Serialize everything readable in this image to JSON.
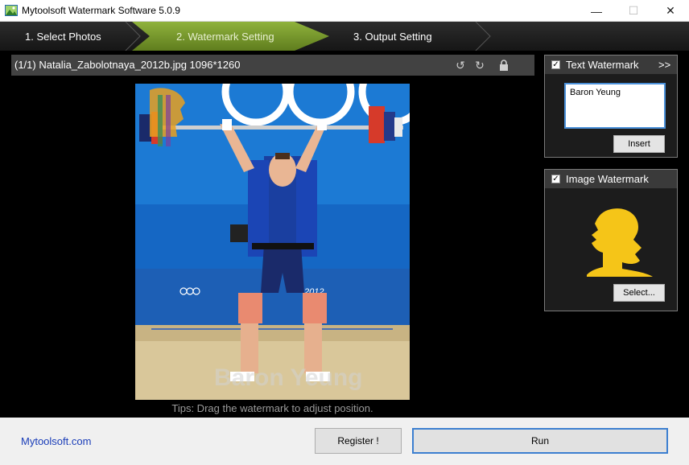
{
  "window": {
    "title": "Mytoolsoft Watermark Software 5.0.9",
    "min_glyph": "—",
    "max_glyph": "☐",
    "close_glyph": "✕"
  },
  "steps": [
    {
      "label": "1. Select Photos",
      "active": false
    },
    {
      "label": "2. Watermark Setting",
      "active": true
    },
    {
      "label": "3. Output Setting",
      "active": false
    }
  ],
  "preview": {
    "file_info": "(1/1) Natalia_Zabolotnaya_2012b.jpg 1096*1260",
    "watermark_text": "Baron Yeung",
    "tips": "Tips: Drag the watermark to adjust position.",
    "photo_caption_olympics": "2012",
    "icons": {
      "rotate_left": "rotate-left-icon",
      "rotate_right": "rotate-right-icon",
      "lock": "lock-icon"
    }
  },
  "text_watermark": {
    "title": "Text Watermark",
    "expand": ">>",
    "checked": true,
    "value": "Baron Yeung",
    "insert_label": "Insert"
  },
  "image_watermark": {
    "title": "Image Watermark",
    "checked": true,
    "select_label": "Select...",
    "logo_color": "#f5c518"
  },
  "footer": {
    "site_link": "Mytoolsoft.com",
    "register_label": "Register !",
    "run_label": "Run"
  },
  "colors": {
    "active_step": "#7ea52f",
    "link": "#1a3db8",
    "focus_border": "#3c7fd0"
  }
}
